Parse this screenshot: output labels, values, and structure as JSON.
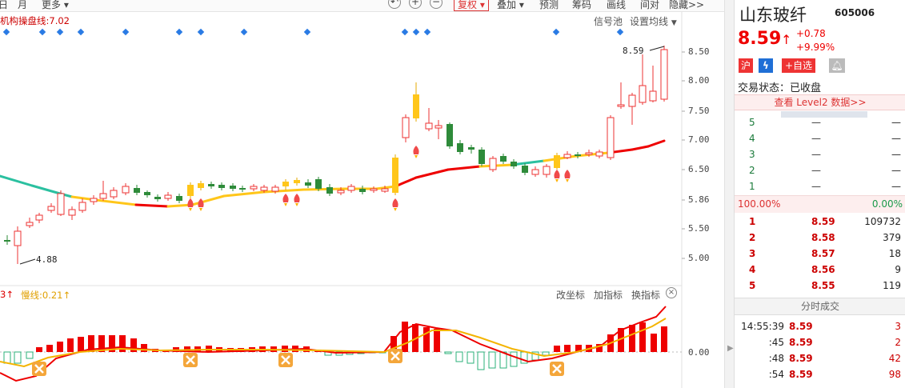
{
  "toolbar": {
    "items": [
      "日",
      "月",
      "更多"
    ],
    "right": [
      "复权",
      "叠加",
      "预测",
      "筹码",
      "画线",
      "间对",
      "隐藏>>"
    ]
  },
  "chart_header": {
    "indicator": "机构操盘线:7.02",
    "signal_pool": "信号池",
    "ma_settings": "设置均线"
  },
  "chart_data": {
    "type": "candlestick",
    "y_ticks": [
      "8.50",
      "8.00",
      "7.50",
      "7.00",
      "6.50",
      "5.86",
      "5.50",
      "5.00"
    ],
    "annotations": {
      "high": "8.59",
      "low": "4.88"
    },
    "sub_indicator": {
      "label_a": "3↑",
      "label_b": "慢线:0.21↑",
      "zero_tick": "0.00"
    }
  },
  "sub_header": {
    "buttons": [
      "改坐标",
      "加指标",
      "换指标"
    ]
  },
  "stock": {
    "name": "山东玻纤",
    "code": "605006",
    "price": "8.59",
    "change": "+0.78",
    "pct": "+9.99%",
    "tags": [
      "沪",
      "+自选"
    ],
    "status_label": "交易状态：",
    "status_value": "已收盘",
    "level2": "查看 Level2 数据>>"
  },
  "sell_book": [
    {
      "lvl": "5",
      "price": "—",
      "vol": "—"
    },
    {
      "lvl": "4",
      "price": "—",
      "vol": "—"
    },
    {
      "lvl": "3",
      "price": "—",
      "vol": "—"
    },
    {
      "lvl": "2",
      "price": "—",
      "vol": "—"
    },
    {
      "lvl": "1",
      "price": "—",
      "vol": "—"
    }
  ],
  "ratio": {
    "left": "100.00%",
    "right": "0.00%"
  },
  "buy_book": [
    {
      "lvl": "1",
      "price": "8.59",
      "vol": "109732"
    },
    {
      "lvl": "2",
      "price": "8.58",
      "vol": "379"
    },
    {
      "lvl": "3",
      "price": "8.57",
      "vol": "18"
    },
    {
      "lvl": "4",
      "price": "8.56",
      "vol": "9"
    },
    {
      "lvl": "5",
      "price": "8.55",
      "vol": "119"
    }
  ],
  "ticks_title": "分时成交",
  "ticks": [
    {
      "t": "14:55:39",
      "p": "8.59",
      "v": "3"
    },
    {
      "t": ":45",
      "p": "8.59",
      "v": "2"
    },
    {
      "t": ":48",
      "p": "8.59",
      "v": "42"
    },
    {
      "t": ":54",
      "p": "8.59",
      "v": "98"
    }
  ]
}
